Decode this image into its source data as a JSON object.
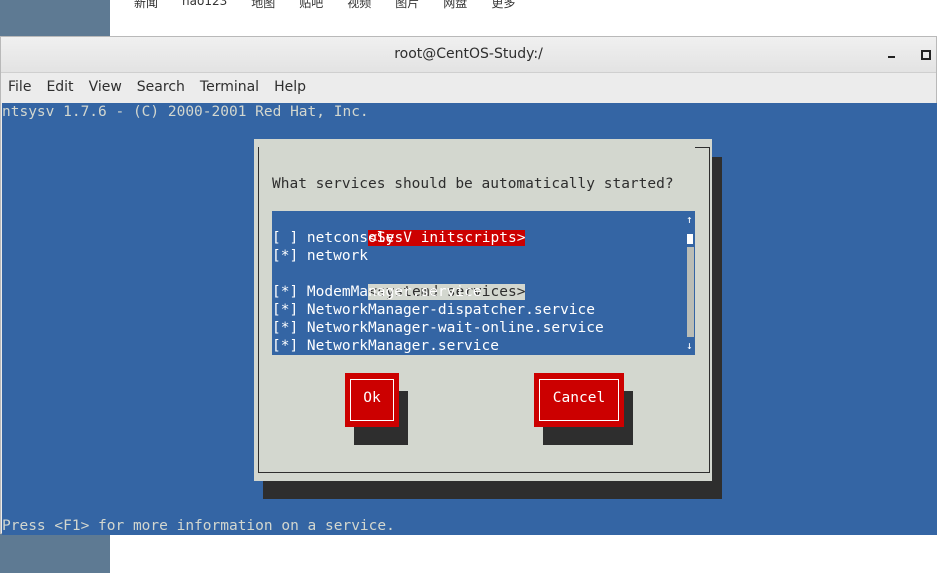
{
  "background": {
    "links": [
      "新闻",
      "hao123",
      "地图",
      "贴吧",
      "视频",
      "图片",
      "网盘",
      "更多"
    ]
  },
  "window": {
    "title": "root@CentOS-Study:/",
    "controls": [
      "minimize",
      "maximize"
    ]
  },
  "menubar": {
    "items": [
      "File",
      "Edit",
      "View",
      "Search",
      "Terminal",
      "Help"
    ]
  },
  "terminal": {
    "header": "ntsysv 1.7.6 - (C) 2000-2001 Red Hat, Inc.",
    "footer": "Press <F1> for more information on a service."
  },
  "dialog": {
    "question": "What services should be automatically started?",
    "groups": {
      "sysv": "<SysV initscripts>",
      "systemd": "<systemd services>"
    },
    "services": {
      "netconsole": "[ ] netconsole",
      "network": "[*] network",
      "modemmanager": "[*] ModemManager.service",
      "nm_dispatcher": "[*] NetworkManager-dispatcher.service",
      "nm_wait_online": "[*] NetworkManager-wait-online.service",
      "networkmanager": "[*] NetworkManager.service"
    },
    "scroll_up": "↑",
    "scroll_down": "↓",
    "ok_label": "Ok",
    "cancel_label": "Cancel"
  },
  "colors": {
    "terminal_bg": "#3465a4",
    "dialog_bg": "#d3d7cf",
    "accent_red": "#cc0000"
  }
}
